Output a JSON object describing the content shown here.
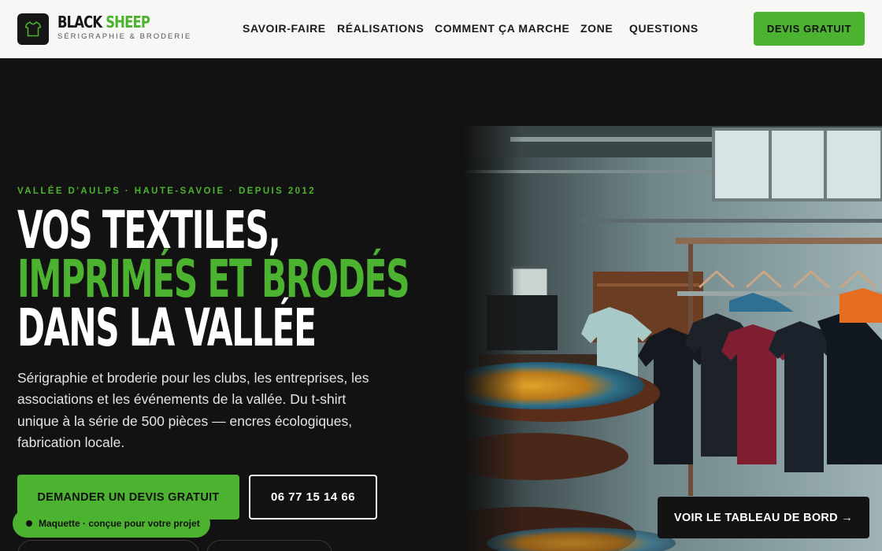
{
  "header": {
    "brand_name_part1": "BLACK",
    "brand_name_part2": "SHEEP",
    "brand_sub": "SÉRIGRAPHIE & BRODERIE",
    "logo_icon": "tshirt-icon",
    "nav": [
      {
        "label": "SAVOIR-FAIRE"
      },
      {
        "label": "RÉALISATIONS"
      },
      {
        "label": "COMMENT ÇA MARCHE"
      },
      {
        "label": "ZONE"
      },
      {
        "label": "QUESTIONS"
      }
    ],
    "cta_label": "DEVIS GRATUIT"
  },
  "hero": {
    "eyebrow": "VALLÉE D'AULPS · HAUTE-SAVOIE · DEPUIS 2012",
    "headline_line1": "VOS TEXTILES,",
    "headline_line2": "IMPRIMÉS ET BRODÉS",
    "headline_line3": "DANS LA VALLÉE",
    "intro": "Sérigraphie et broderie pour les clubs, les entreprises, les associations et les événements de la vallée. Du t-shirt unique à la série de 500 pièces — encres écologiques, fabrication locale.",
    "primary_button": "DEMANDER UN DEVIS GRATUIT",
    "phone_button": "06 77 15 14 66"
  },
  "mockup_badge": "Maquette · conçue pour votre projet",
  "dashboard_button": "VOIR LE TABLEAU DE BORD →",
  "colors": {
    "accent": "#4cb330",
    "background": "#121212",
    "header_bg": "#f7f7f5"
  }
}
